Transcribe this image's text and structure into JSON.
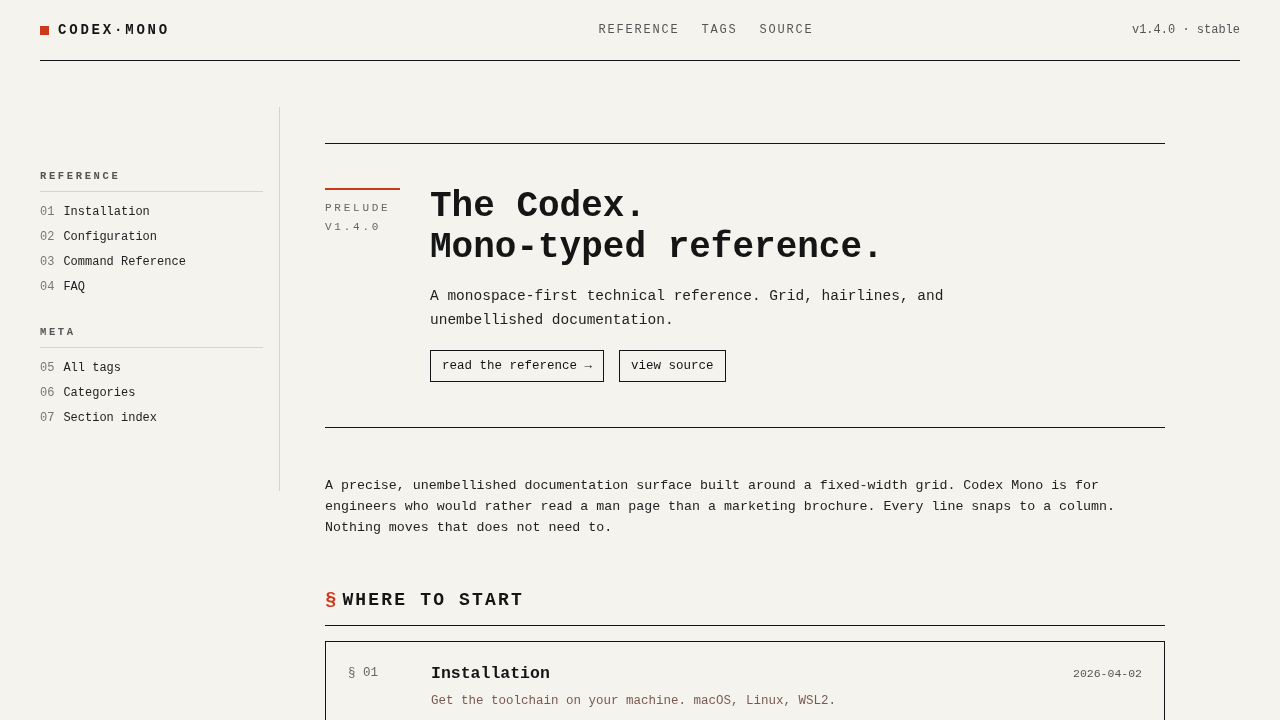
{
  "header": {
    "logo": "CODEX·MONO",
    "nav": [
      {
        "label": "REFERENCE"
      },
      {
        "label": "TAGS"
      },
      {
        "label": "SOURCE"
      }
    ],
    "version": "v1.4.0 · stable"
  },
  "sidebar": {
    "groups": [
      {
        "title": "REFERENCE",
        "items": [
          {
            "number": "01",
            "label": "Installation"
          },
          {
            "number": "02",
            "label": "Configuration"
          },
          {
            "number": "03",
            "label": "Command Reference"
          },
          {
            "number": "04",
            "label": "FAQ"
          }
        ]
      },
      {
        "title": "META",
        "items": [
          {
            "number": "05",
            "label": "All tags"
          },
          {
            "number": "06",
            "label": "Categories"
          },
          {
            "number": "07",
            "label": "Section index"
          }
        ]
      }
    ]
  },
  "hero": {
    "eyebrow": "PRELUDE",
    "version": "V1.4.0",
    "title_lines": [
      "The Codex.",
      "Mono-typed reference."
    ],
    "lead": "A monospace-first technical reference. Grid, hairlines, and unembellished documentation.",
    "buttons": [
      {
        "label": "read the reference →"
      },
      {
        "label": "view source"
      }
    ]
  },
  "intro": "A precise, unembellished documentation surface built around a fixed-width grid. Codex Mono is for engineers who would rather read a man page than a marketing brochure. Every line snaps to a column. Nothing moves that does not need to.",
  "section": {
    "mark": "§",
    "title": "WHERE TO START",
    "cards": [
      {
        "number": "§ 01",
        "title": "Installation",
        "date": "2026-04-02",
        "description": "Get the toolchain on your machine. macOS, Linux, WSL2."
      }
    ]
  }
}
